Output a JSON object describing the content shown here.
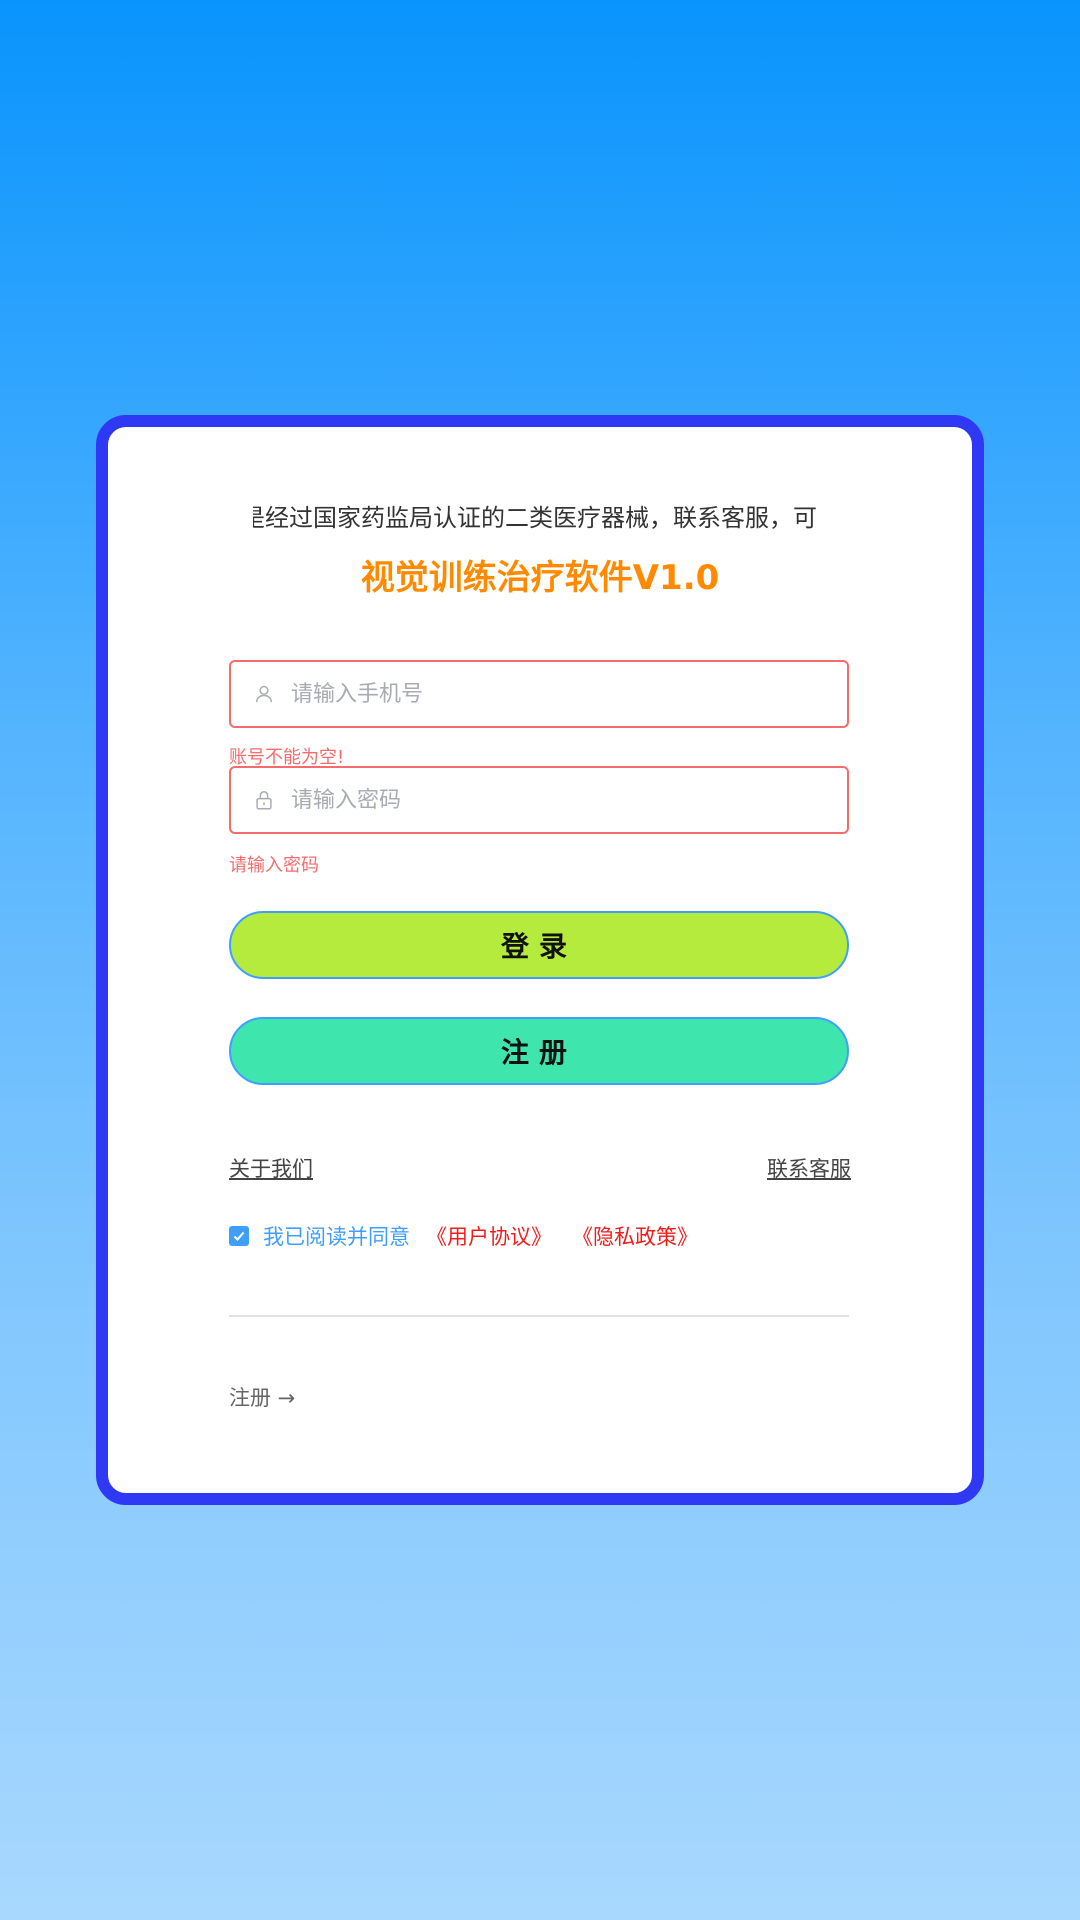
{
  "notice": {
    "marquee_text": "是经过国家药监局认证的二类医疗器械，联系客服，可I"
  },
  "app": {
    "title": "视觉训练治疗软件V1.0"
  },
  "form": {
    "phone": {
      "placeholder": "请输入手机号",
      "value": "",
      "error": "账号不能为空!"
    },
    "password": {
      "placeholder": "请输入密码",
      "value": "",
      "error": "请输入密码"
    }
  },
  "buttons": {
    "login_label": "登录",
    "register_label": "注册"
  },
  "links": {
    "about_us": "关于我们",
    "contact_service": "联系客服"
  },
  "agreement": {
    "checked": true,
    "text": "我已阅读并同意",
    "user_agreement": "《用户协议》",
    "privacy_policy": "《隐私政策》"
  },
  "footer": {
    "register_link": "注册 →"
  },
  "colors": {
    "frame": "#2f38f2",
    "title": "#ff8a00",
    "login_button": "#b5eb3c",
    "register_button": "#3ee6ad",
    "error": "#f56c6c",
    "accent": "#409eff",
    "policy": "#f51b1b"
  },
  "icons": {
    "phone_field": "user-icon",
    "password_field": "lock-icon",
    "checkbox": "checkmark-icon"
  }
}
